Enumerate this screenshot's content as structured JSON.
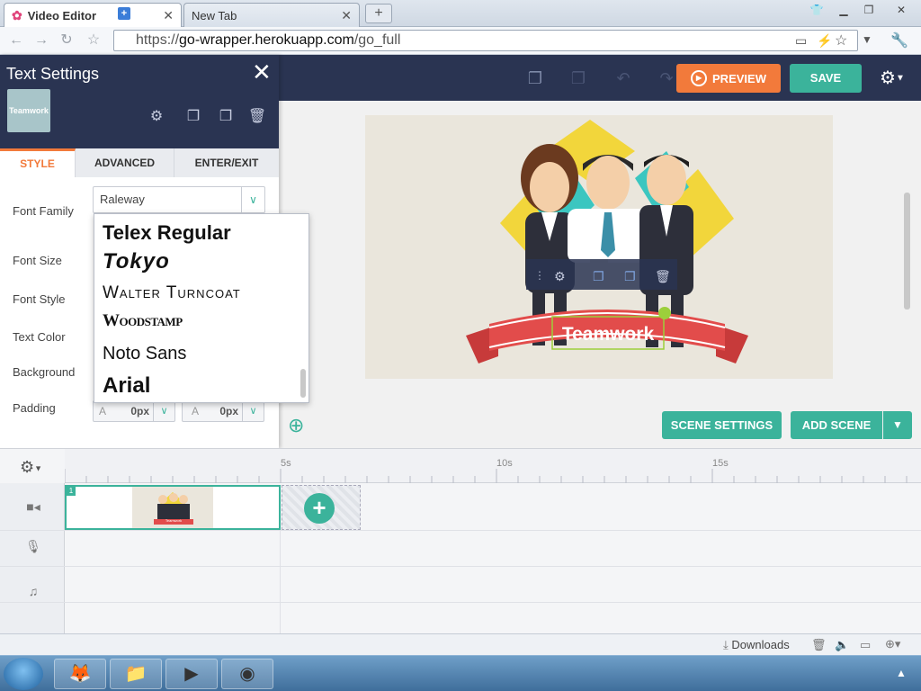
{
  "browser": {
    "tabs": [
      {
        "label": "Video Editor",
        "active": true
      },
      {
        "label": "New Tab",
        "active": false
      }
    ],
    "url_scheme": "https://",
    "url_domain": "go-wrapper.herokuapp.com",
    "url_path": "/go_full"
  },
  "header": {
    "preview_label": "PREVIEW",
    "save_label": "SAVE"
  },
  "panel": {
    "title": "Text Settings",
    "thumbnail_text": "Teamwork",
    "tabs": [
      "STYLE",
      "ADVANCED",
      "ENTER/EXIT"
    ],
    "active_tab": "STYLE",
    "labels": {
      "font_family": "Font Family",
      "font_size": "Font Size",
      "font_style": "Font Style",
      "text_color": "Text Color",
      "background": "Background",
      "padding": "Padding"
    },
    "font_family_value": "Raleway",
    "padding_values": [
      "0px",
      "0px"
    ]
  },
  "font_dropdown": {
    "options": [
      "Telex Regular",
      "Tokyo",
      "Walter Turncoat",
      "Woodstamp",
      "Noto Sans",
      "Arial"
    ]
  },
  "stage": {
    "banner_text": "Teamwork"
  },
  "scene_buttons": {
    "scene_settings": "SCENE SETTINGS",
    "add_scene": "ADD SCENE"
  },
  "timeline": {
    "ticks": [
      "5s",
      "10s",
      "15s"
    ],
    "clip_number": "1",
    "thumb_text": "Teamwork"
  },
  "statusbar": {
    "downloads_label": "Downloads"
  },
  "colors": {
    "navy": "#2a3452",
    "accent_green": "#3bb39b",
    "accent_orange": "#f27a3b",
    "banner_red": "#e24c4b"
  }
}
